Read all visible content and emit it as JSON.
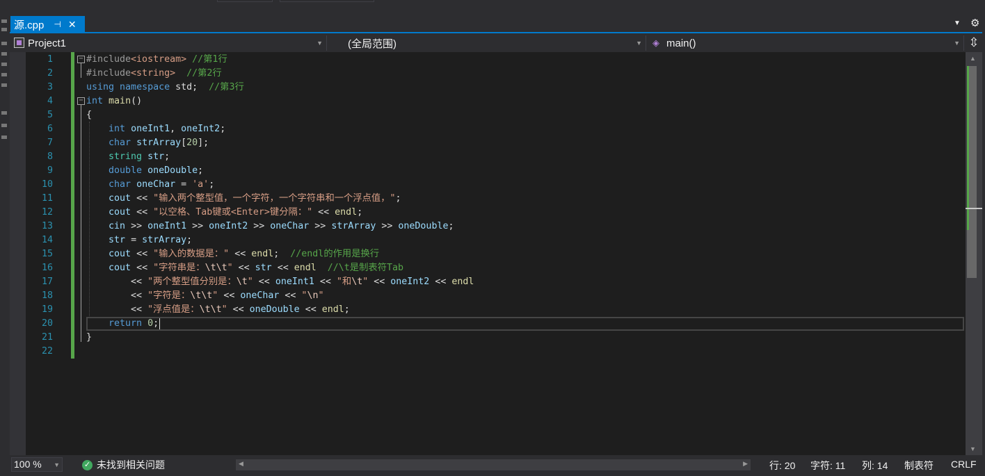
{
  "tab": {
    "filename": "源.cpp",
    "pin_glyph": "⊣",
    "close_glyph": "✕"
  },
  "navbar": {
    "project": "Project1",
    "scope": "(全局范围)",
    "member": "main()"
  },
  "editor": {
    "line_numbers": [
      "1",
      "2",
      "3",
      "4",
      "5",
      "6",
      "7",
      "8",
      "9",
      "10",
      "11",
      "12",
      "13",
      "14",
      "15",
      "16",
      "17",
      "18",
      "19",
      "20",
      "21",
      "22"
    ],
    "current_line": 20
  },
  "status": {
    "zoom": "100 %",
    "issues": "未找到相关问题",
    "line": "行: 20",
    "char": "字符: 11",
    "col": "列: 14",
    "indent": "制表符",
    "eol": "CRLF"
  },
  "colors": {
    "accent": "#007acc",
    "change_bar": "#57a64a",
    "line_number": "#2b91af",
    "keyword": "#569cd6",
    "string": "#d69d85",
    "comment": "#57a64a"
  },
  "icons": [
    "split-editor-icon",
    "settings-gear-icon",
    "pin-icon",
    "close-icon",
    "project-icon",
    "member-cube-icon",
    "check-icon"
  ]
}
